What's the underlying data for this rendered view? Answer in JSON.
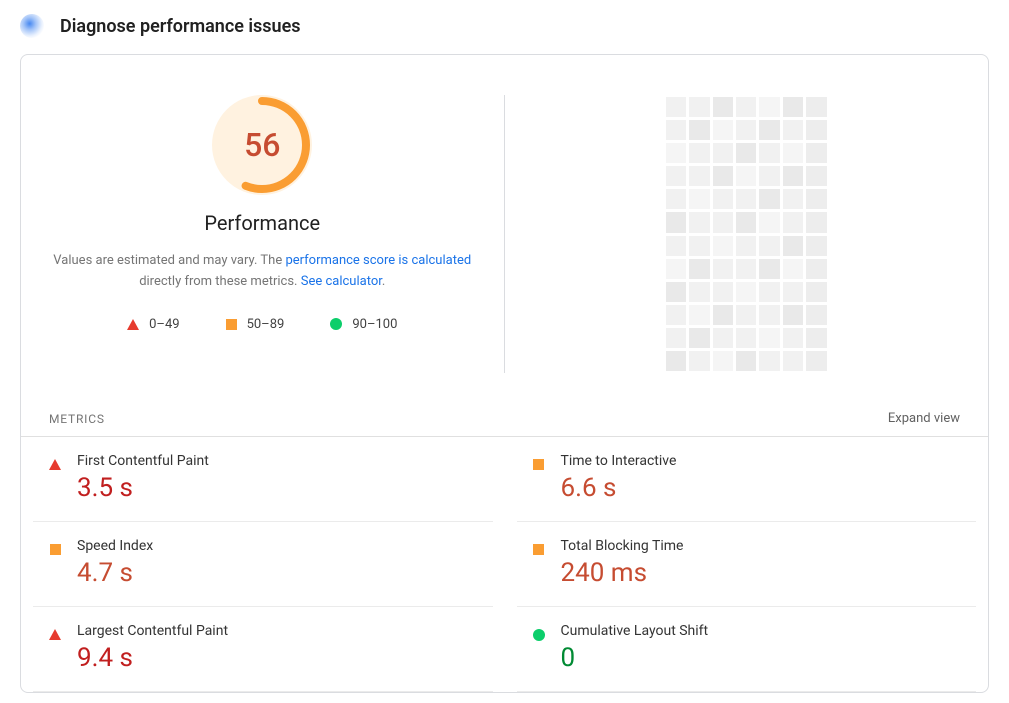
{
  "header": {
    "title": "Diagnose performance issues",
    "icon": "gauge-icon"
  },
  "score": {
    "value": 56,
    "max": 100,
    "category": "Performance",
    "color_arc": "#fa9d32",
    "color_bg": "#fff2e0",
    "color_text": "#c64c31",
    "desc_pre": "Values are estimated and may vary. The ",
    "desc_link1": "performance score is calculated",
    "desc_mid": " directly from these metrics. ",
    "desc_link2": "See calculator",
    "desc_post": "."
  },
  "legend": [
    {
      "shape": "triangle",
      "label": "0–49"
    },
    {
      "shape": "square",
      "label": "50–89"
    },
    {
      "shape": "circle",
      "label": "90–100"
    }
  ],
  "metrics_header": {
    "label": "METRICS",
    "expand": "Expand view"
  },
  "metrics": [
    {
      "shape": "triangle",
      "name": "First Contentful Paint",
      "value": "3.5 s",
      "val_class": "val-red"
    },
    {
      "shape": "square",
      "name": "Time to Interactive",
      "value": "6.6 s",
      "val_class": "val-orange"
    },
    {
      "shape": "square",
      "name": "Speed Index",
      "value": "4.7 s",
      "val_class": "val-orange"
    },
    {
      "shape": "square",
      "name": "Total Blocking Time",
      "value": "240 ms",
      "val_class": "val-orange"
    },
    {
      "shape": "triangle",
      "name": "Largest Contentful Paint",
      "value": "9.4 s",
      "val_class": "val-red"
    },
    {
      "shape": "circle",
      "name": "Cumulative Layout Shift",
      "value": "0",
      "val_class": "val-green"
    }
  ],
  "chart_data": {
    "type": "gauge",
    "title": "Performance",
    "value": 56,
    "range": [
      0,
      100
    ],
    "bands": [
      {
        "label": "0–49",
        "color": "#e63b2e"
      },
      {
        "label": "50–89",
        "color": "#fa9d32"
      },
      {
        "label": "90–100",
        "color": "#0cce6b"
      }
    ]
  }
}
